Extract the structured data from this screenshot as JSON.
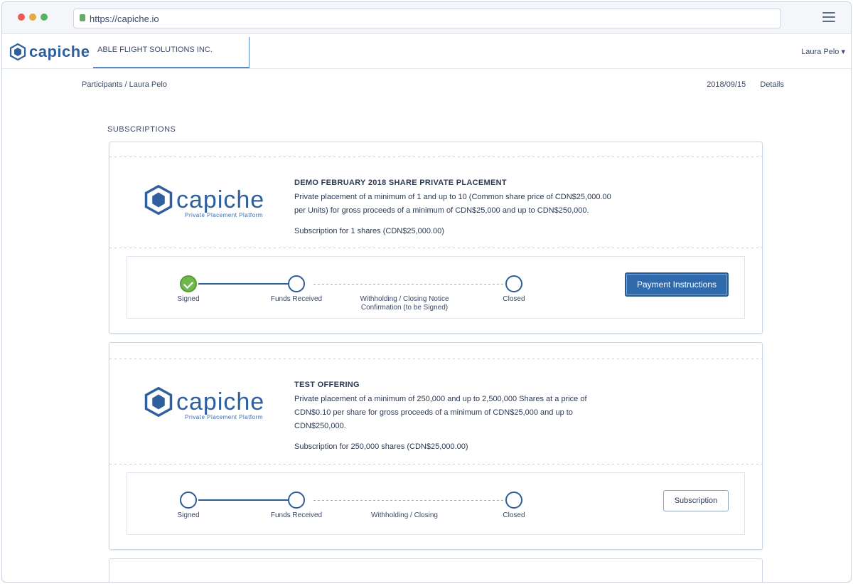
{
  "browser": {
    "url": "https://capiche.io"
  },
  "app": {
    "brand": "capiche",
    "company": "ABLE FLIGHT SOLUTIONS INC.",
    "user_menu": "Laura Pelo"
  },
  "breadcrumb": {
    "parent": "Participants",
    "separator": "/",
    "current": "Laura Pelo"
  },
  "top_actions": {
    "date": "2018/09/15",
    "details_link": "Details"
  },
  "subscriptions": {
    "heading": "SUBSCRIPTIONS",
    "items": [
      {
        "logo_name": "capiche",
        "logo_tagline": "Private Placement Platform",
        "title": "DEMO FEBRUARY 2018 SHARE PRIVATE PLACEMENT",
        "description": "Private placement of a minimum of 1 and up to 10 (Common share price of CDN$25,000.00 per Units) for gross proceeds of a minimum of CDN$25,000 and up to CDN$250,000.",
        "subscription": "Subscription for 1 shares (CDN$25,000.00)",
        "steps": [
          "Signed",
          "Funds Received",
          "Withholding / Closing Notice Confirmation (to be Signed)",
          "Closed"
        ],
        "action_label": "Payment Instructions"
      },
      {
        "logo_name": "capiche",
        "logo_tagline": "Private Placement Platform",
        "title": "TEST OFFERING",
        "description": "Private placement of a minimum of 250,000 and up to 2,500,000 Shares at a price of CDN$0.10 per share for gross proceeds of a minimum of CDN$25,000 and up to CDN$250,000.",
        "subscription": "Subscription for 250,000 shares (CDN$25,000.00)",
        "steps": [
          "Signed",
          "Funds Received",
          "Withholding / Closing",
          "Closed"
        ],
        "action_label": "Subscription"
      }
    ]
  },
  "colors": {
    "brand_blue": "#2f5f9c",
    "primary_button": "#2f6aad",
    "done_green": "#6fb84a"
  },
  "icons": {
    "menu": "hamburger-icon",
    "lock": "lock-icon",
    "done": "checkmark-icon"
  }
}
